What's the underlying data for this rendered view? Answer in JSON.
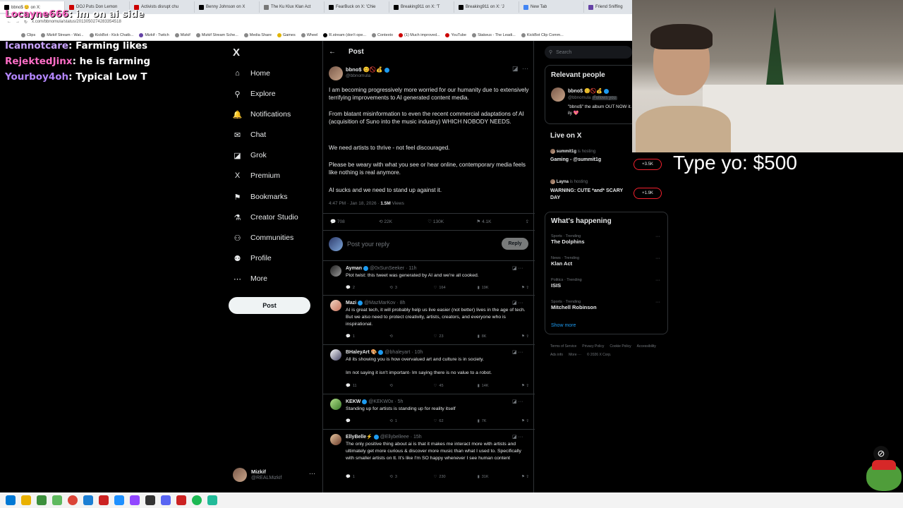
{
  "browser": {
    "tabs": [
      "bbno$ 😊 on X:",
      "DOJ Puts Don Lemon",
      "Activists disrupt chu",
      "Benny Johnson on X",
      "The Ku Klux Klan Act",
      "FearBuck on X: 'Chie",
      "Breaking911 on X: 'T",
      "Breaking911 on X: 'J",
      "New Tab",
      "Friend Sniffing"
    ],
    "url": "x.com/bbnomula/status/2013050274283354518",
    "bookmarks": [
      "Clips",
      "Mizkif Stream - Wat...",
      "KickBot - Kick Chatb...",
      "Mizkif - Twitch",
      "Mizkif",
      "Mizkif Stream Sche...",
      "Media Share",
      "Games",
      "Wheel",
      "R.stream (don't ope...",
      "Contexto",
      "(1) Much improved...",
      "YouTube",
      "Stakeus - The Leadi...",
      "KickBot Clip Comm..."
    ]
  },
  "chat": [
    {
      "user": "Locayne666",
      "msg": ": im on ai side"
    },
    {
      "user": "Icannotcare",
      "msg": ": Farming likes"
    },
    {
      "user": "RejektedJinx",
      "msg": ": he is farming"
    },
    {
      "user": "Yourboy4oh",
      "msg": ": Typical Low T"
    }
  ],
  "nav": {
    "logo": "X",
    "items": [
      {
        "label": "Home",
        "icon": "⌂"
      },
      {
        "label": "Explore",
        "icon": "⚲"
      },
      {
        "label": "Notifications",
        "icon": "🔔"
      },
      {
        "label": "Chat",
        "icon": "✉"
      },
      {
        "label": "Grok",
        "icon": "◪"
      },
      {
        "label": "Premium",
        "icon": "X"
      },
      {
        "label": "Bookmarks",
        "icon": "⚑"
      },
      {
        "label": "Creator Studio",
        "icon": "⚗"
      },
      {
        "label": "Communities",
        "icon": "⚇"
      },
      {
        "label": "Profile",
        "icon": "⚉"
      },
      {
        "label": "More",
        "icon": "⋯"
      }
    ],
    "post_label": "Post",
    "account_name": "Mizkif",
    "account_handle": "@REALMizkif"
  },
  "post": {
    "header": "Post",
    "author": "bbno$ 😊🚫💰",
    "handle": "@bbnomula",
    "p1": "I am becoming progressively more worried for our humanity due to extensively terrifying improvements to AI generated content media.",
    "p2": "From blatant misinformation to even the recent commercial adaptations of AI (acquisition of Suno into the music industry) WHICH NOBODY NEEDS.",
    "p3": "We need artists to thrive - not feel discouraged.",
    "p4": "Please be weary with what you see or hear online, contemporary media feels like nothing is real anymore.",
    "p5": "AI sucks and we need to stand up against it.",
    "time": "4:47 PM · Jan 18, 2026 · ",
    "views": "1.5M",
    "views_label": "Views",
    "replies": "708",
    "reposts": "22K",
    "likes": "130K",
    "bookmarks": "4.1K",
    "reply_placeholder": "Post your reply",
    "reply_button": "Reply"
  },
  "replies": [
    {
      "name": "Ayman",
      "handle": "@0xSunSeeker · 11h",
      "text": "Plot twist: this tweet was generated by AI and we're all cooked.",
      "r": "2",
      "rt": "3",
      "l": "164",
      "v": "19K"
    },
    {
      "name": "Mazi",
      "handle": "@MazMarKov · 8h",
      "text": "AI is great tech, it will probably help us live easier (not better) lives in the age of tech. But we also need to protect creativity, artists, creators, and everyone who is inspirational.",
      "r": "1",
      "rt": "",
      "l": "23",
      "v": "8K"
    },
    {
      "name": "BHaleyArt 🎨",
      "handle": "@bhaleyart · 10h",
      "text": "All its showing you is how overvalued art and culture is in society.",
      "text2": "Im not saying it isn't important- Im saying there is no value to a robot.",
      "r": "11",
      "rt": "",
      "l": "45",
      "v": "14K"
    },
    {
      "name": "KEKW",
      "handle": "@KEKW0x · 5h",
      "text": "Standing up for artists is standing up for reality itself",
      "r": "",
      "rt": "1",
      "l": "62",
      "v": "7K"
    },
    {
      "name": "EllyBelle⚡",
      "handle": "@Ellybelleee · 15h",
      "text": "The only positive thing about ai is that it makes me interact more with artists and ultimately get more curious & discover more music than what I used to. Specifically with smaller artists on tt. It's like I'm SO happy whenever I see human content",
      "r": "1",
      "rt": "3",
      "l": "230",
      "v": "31K"
    }
  ],
  "search_placeholder": "Search",
  "relevant": {
    "title": "Relevant people",
    "name": "bbno$ 😊🚫💰",
    "handle": "@bbnomula",
    "follows": "Follows you",
    "bio": "\"bbno$\" the album OUT NOW it. ily 💖"
  },
  "live": {
    "title": "Live on X",
    "items": [
      {
        "host": "summit1g",
        "status": "is hosting",
        "title": "Gaming - @summit1g",
        "count": "+3.5K"
      },
      {
        "host": "Layna",
        "status": "is hosting",
        "title": "WARNING: CUTE *and* SCARY DAY",
        "count": "+1.9K"
      }
    ]
  },
  "happening": {
    "title": "What's happening",
    "trends": [
      {
        "cat": "Sports · Trending",
        "name": "The Dolphins"
      },
      {
        "cat": "News · Trending",
        "name": "Klan Act"
      },
      {
        "cat": "Politics · Trending",
        "name": "ISIS"
      },
      {
        "cat": "Sports · Trending",
        "name": "Mitchell Robinson"
      }
    ],
    "show_more": "Show more"
  },
  "footer": [
    "Terms of Service",
    "Privacy Policy",
    "Cookie Policy",
    "Accessibility",
    "Ads info",
    "More ···",
    "© 2026 X Corp."
  ],
  "donation": "Type yo: $500",
  "colors": {
    "accent": "#1d9bf0",
    "bg": "#000000",
    "muted": "#71767b"
  }
}
